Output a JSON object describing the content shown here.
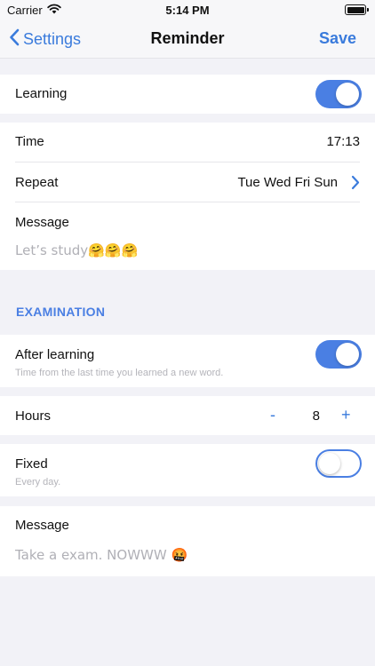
{
  "status": {
    "carrier": "Carrier",
    "time": "5:14 PM"
  },
  "nav": {
    "back_label": "Settings",
    "title": "Reminder",
    "save_label": "Save"
  },
  "learning": {
    "label": "Learning",
    "enabled": true
  },
  "time": {
    "label": "Time",
    "value": "17:13"
  },
  "repeat": {
    "label": "Repeat",
    "value": "Tue Wed Fri Sun"
  },
  "message1": {
    "label": "Message",
    "placeholder": "Let’s study🤗🤗🤗"
  },
  "examination": {
    "header": "EXAMINATION",
    "after_learning": {
      "label": "After learning",
      "sub": "Time from the last time you learned a new word.",
      "enabled": true
    },
    "hours": {
      "label": "Hours",
      "decrement": "-",
      "value": "8",
      "increment": "+"
    },
    "fixed": {
      "label": "Fixed",
      "sub": "Every day.",
      "enabled": false
    },
    "message": {
      "label": "Message",
      "placeholder": "Take a exam. NOWWW 🤬"
    }
  },
  "colors": {
    "accent": "#4a7fe3",
    "background": "#f2f2f7"
  }
}
